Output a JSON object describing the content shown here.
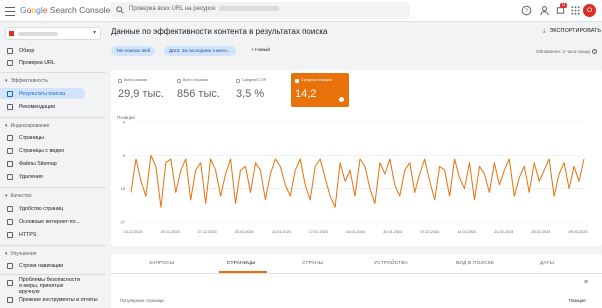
{
  "app": {
    "title_parts": [
      "G",
      "o",
      "o",
      "g",
      "l",
      "e"
    ],
    "title_rest": " Search Console",
    "search_placeholder": "Проверка всех URL на ресурсе",
    "notif_count": "14",
    "avatar_letter": "О",
    "brand_colors": {
      "blue": "#4285f4",
      "red": "#ea4335",
      "yellow": "#fbbc05",
      "green": "#34a853"
    }
  },
  "sidebar": {
    "top_items": [
      {
        "label": "Обзор",
        "icon": "home-icon"
      },
      {
        "label": "Проверка URL",
        "icon": "search-icon"
      }
    ],
    "sections": [
      {
        "title": "Эффективность",
        "items": [
          {
            "label": "Результаты поиска",
            "icon": "google-g-icon",
            "active": true
          },
          {
            "label": "Рекомендации",
            "icon": "lightbulb-icon"
          }
        ]
      },
      {
        "title": "Индексирование",
        "items": [
          {
            "label": "Страницы",
            "icon": "pages-icon"
          },
          {
            "label": "Страницы с видео",
            "icon": "video-icon"
          },
          {
            "label": "Файлы Sitemap",
            "icon": "sitemap-icon"
          },
          {
            "label": "Удаления",
            "icon": "removals-icon"
          }
        ]
      },
      {
        "title": "Качество",
        "items": [
          {
            "label": "Удобство страниц",
            "icon": "experience-icon"
          },
          {
            "label": "Основные интернет-по...",
            "icon": "speed-icon"
          },
          {
            "label": "HTTPS",
            "icon": "lock-icon"
          }
        ]
      },
      {
        "title": "Улучшения",
        "items": [
          {
            "label": "Строки навигации",
            "icon": "breadcrumbs-icon"
          }
        ]
      }
    ],
    "bottom_items": [
      {
        "label": "Проблемы безопасности и меры, принятые вручную",
        "icon": "shield-icon"
      },
      {
        "label": "Прежние инструменты и отчеты",
        "icon": "legacy-icon"
      }
    ]
  },
  "main": {
    "title": "Данные по эффективности контента в результатах поиска",
    "export_label": "ЭКСПОРТИРОВАТЬ",
    "filters": [
      "Тип поиска: Веб",
      "Дата: За последние 3 меся..."
    ],
    "new_filter": "Новый",
    "updated": "Обновлено: 2 часа назад",
    "metrics": [
      {
        "label": "Всего кликов",
        "value": "29,9 тыс.",
        "selected": false
      },
      {
        "label": "Всего показов",
        "value": "856 тыс.",
        "selected": false
      },
      {
        "label": "Средний CTR",
        "value": "3,5 %",
        "selected": false
      },
      {
        "label": "Средняя позиция",
        "value": "14,2",
        "selected": true
      }
    ],
    "tabs": [
      {
        "label": "ЗАПРОСЫ",
        "active": false
      },
      {
        "label": "СТРАНИЦЫ",
        "active": true
      },
      {
        "label": "СТРАНЫ",
        "active": false
      },
      {
        "label": "УСТРОЙСТВА",
        "active": false
      },
      {
        "label": "ВИД В ПОИСКЕ",
        "active": false
      },
      {
        "label": "ДАТЫ",
        "active": false
      }
    ],
    "table_header": "Популярные страницы",
    "table_metric": "Позиция",
    "accent_color": "#e8710a"
  },
  "chart_data": {
    "type": "line",
    "ylabel": "Позиция",
    "yticks": [
      "0",
      "9",
      "18",
      "27"
    ],
    "ylim": [
      0,
      27
    ],
    "inverted_y": true,
    "x_ticks": [
      "13.12.2023",
      "20.12.2023",
      "27.12.2023",
      "03.01.2024",
      "10.01.2024",
      "17.01.2024",
      "24.01.2024",
      "31.01.2024",
      "07.02.2024",
      "14.02.2024",
      "21.02.2024",
      "28.02.2024",
      "06.03.2024"
    ],
    "series": [
      {
        "color": "#e8710a",
        "values": [
          19,
          10,
          16,
          20,
          9,
          12,
          23,
          11,
          10,
          19,
          13,
          10,
          21,
          13,
          11,
          22,
          10,
          13,
          20,
          14,
          10,
          22,
          13,
          12,
          19,
          11,
          13,
          21,
          14,
          10,
          12,
          17,
          20,
          13,
          10,
          17,
          21,
          12,
          10,
          15,
          20,
          23,
          11,
          16,
          13,
          20,
          10,
          12,
          18,
          22,
          11,
          14,
          10,
          17,
          20,
          13,
          11,
          19,
          14,
          10,
          16,
          21,
          12,
          13,
          20,
          10,
          15,
          18,
          11,
          21,
          12,
          14,
          19,
          11,
          17,
          13,
          10,
          20,
          15,
          12,
          19,
          11,
          16,
          13,
          10,
          20,
          14,
          11,
          18,
          12,
          16,
          10
        ]
      }
    ]
  }
}
